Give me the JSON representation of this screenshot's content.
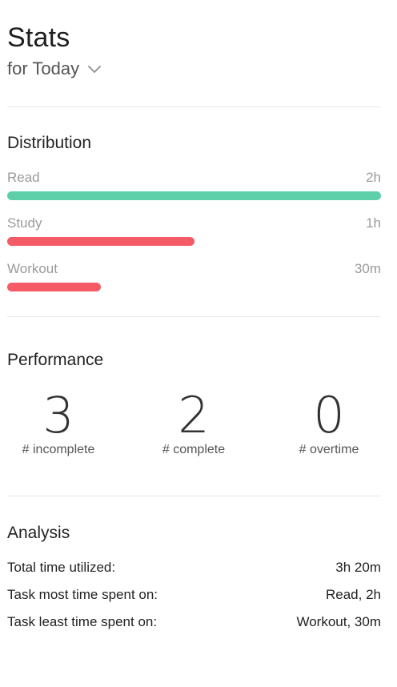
{
  "header": {
    "title": "Stats",
    "period_label": "for Today"
  },
  "distribution": {
    "title": "Distribution",
    "items": [
      {
        "label": "Read",
        "value": "2h",
        "fraction": 1.0,
        "color": "#5dcfa9"
      },
      {
        "label": "Study",
        "value": "1h",
        "fraction": 0.5,
        "color": "#f45b66"
      },
      {
        "label": "Workout",
        "value": "30m",
        "fraction": 0.25,
        "color": "#f45b66"
      }
    ]
  },
  "performance": {
    "title": "Performance",
    "items": [
      {
        "number": "3",
        "caption": "# incomplete"
      },
      {
        "number": "2",
        "caption": "# complete"
      },
      {
        "number": "0",
        "caption": "# overtime"
      }
    ]
  },
  "analysis": {
    "title": "Analysis",
    "rows": [
      {
        "key": "Total time utilized:",
        "value": "3h 20m"
      },
      {
        "key": "Task most time spent on:",
        "value": "Read, 2h"
      },
      {
        "key": "Task least time spent on:",
        "value": "Workout, 30m"
      }
    ]
  },
  "icons": {
    "period_dropdown": "chevron-down-icon"
  }
}
